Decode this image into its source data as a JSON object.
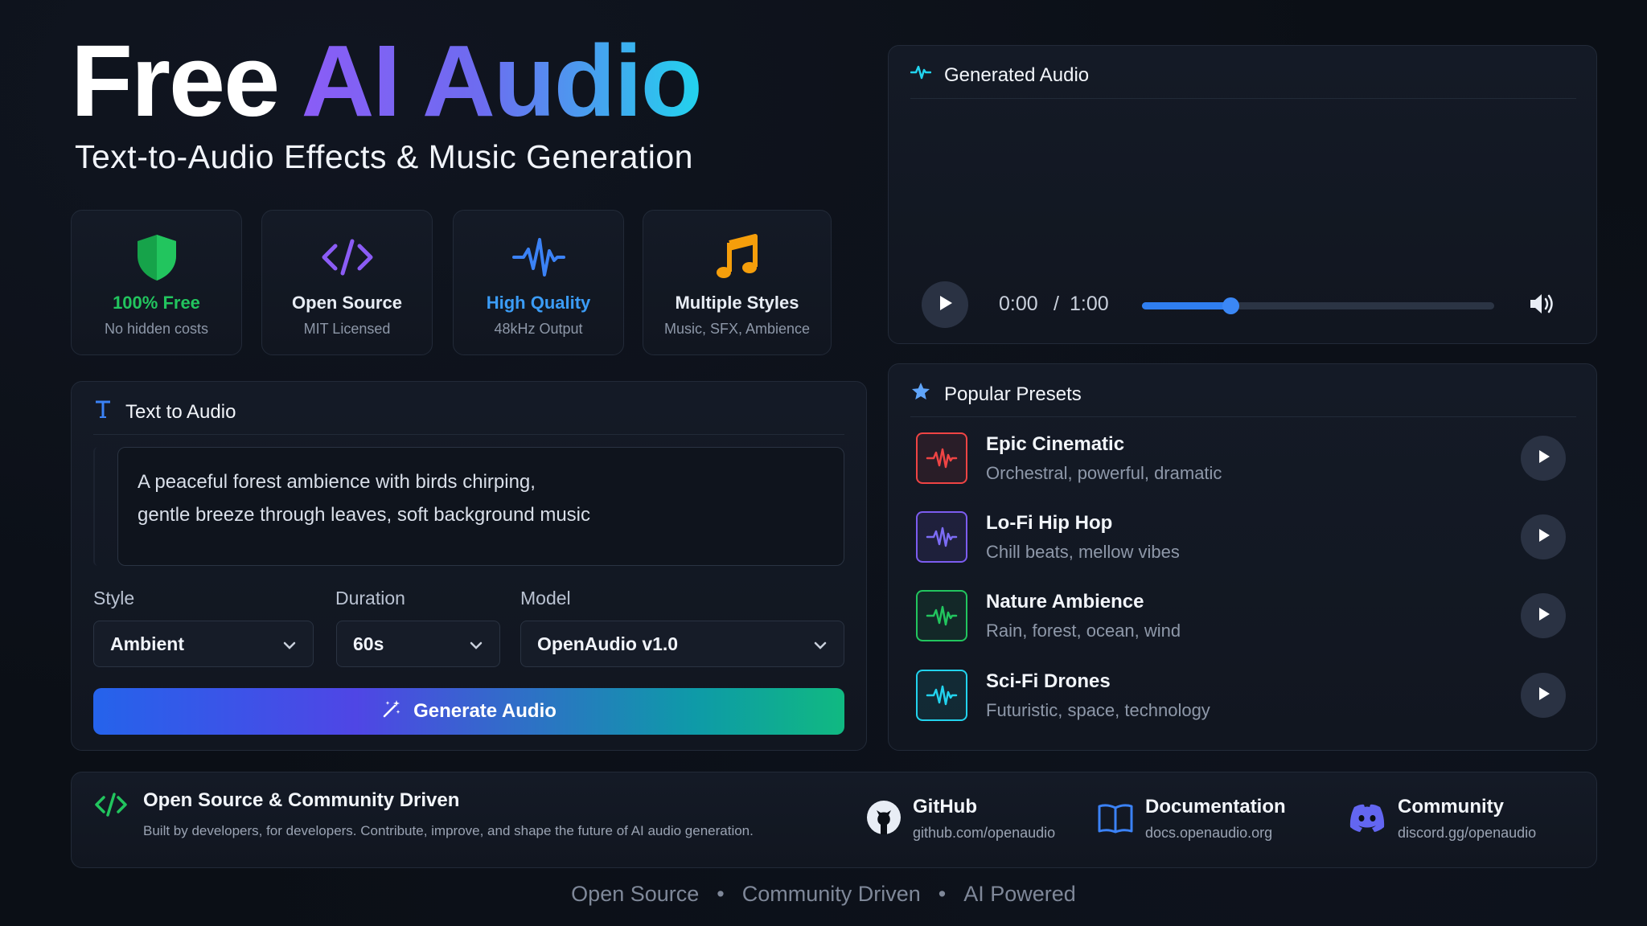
{
  "hero": {
    "title_part1": "Free",
    "title_part2": "AI Audio",
    "subtitle": "Text-to-Audio Effects & Music Generation"
  },
  "features": [
    {
      "title": "100% Free",
      "subtitle": "No hidden costs",
      "icon": "shield-icon",
      "color": "#22c55e"
    },
    {
      "title": "Open Source",
      "subtitle": "MIT Licensed",
      "icon": "code-icon",
      "color": "#8b5cf6"
    },
    {
      "title": "High Quality",
      "subtitle": "48kHz Output",
      "icon": "waveform-icon",
      "color": "#3b82f6"
    },
    {
      "title": "Multiple Styles",
      "subtitle": "Music, SFX, Ambience",
      "icon": "music-note-icon",
      "color": "#f59e0b"
    }
  ],
  "text_to_audio": {
    "heading": "Text to Audio",
    "prompt_line1": "A peaceful forest ambience with birds chirping,",
    "prompt_line2": "gentle breeze through leaves, soft background music",
    "style_label": "Style",
    "style_value": "Ambient",
    "duration_label": "Duration",
    "duration_value": "60s",
    "model_label": "Model",
    "model_value": "OpenAudio v1.0",
    "generate_label": "Generate Audio"
  },
  "player": {
    "heading": "Generated Audio",
    "current_time": "0:00",
    "separator": "/",
    "total_time": "1:00",
    "progress": 0.25
  },
  "presets": {
    "heading": "Popular Presets",
    "items": [
      {
        "name": "Epic Cinematic",
        "desc": "Orchestral, powerful, dramatic",
        "color": "#ef4444"
      },
      {
        "name": "Lo-Fi Hip Hop",
        "desc": "Chill beats, mellow vibes",
        "color": "#8b5cf6"
      },
      {
        "name": "Nature Ambience",
        "desc": "Rain, forest, ocean, wind",
        "color": "#22c55e"
      },
      {
        "name": "Sci-Fi Drones",
        "desc": "Futuristic, space, technology",
        "color": "#22d3ee"
      }
    ]
  },
  "community": {
    "title": "Open Source & Community Driven",
    "subtitle": "Built by developers, for developers. Contribute, improve, and shape the future of AI audio generation.",
    "links": [
      {
        "title": "GitHub",
        "url": "github.com/openaudio",
        "icon": "github-icon"
      },
      {
        "title": "Documentation",
        "url": "docs.openaudio.org",
        "icon": "book-icon"
      },
      {
        "title": "Community",
        "url": "discord.gg/openaudio",
        "icon": "discord-icon"
      }
    ]
  },
  "tagline": {
    "items": [
      "Open Source",
      "Community Driven",
      "AI Powered"
    ],
    "separator": "•"
  }
}
